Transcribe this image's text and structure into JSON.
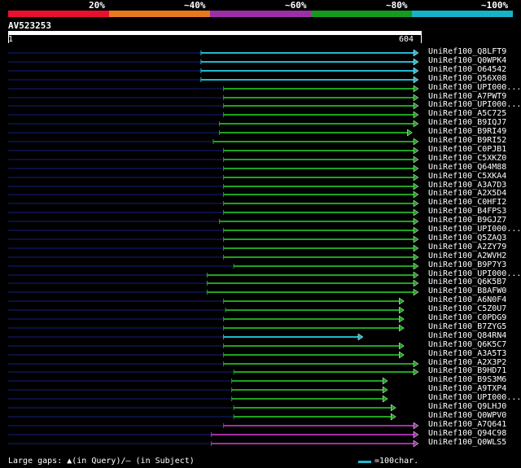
{
  "scale": {
    "segments": [
      {
        "color": "#e8112d"
      },
      {
        "color": "#e8781e"
      },
      {
        "color": "#9c2ea8"
      },
      {
        "color": "#169a1e"
      },
      {
        "color": "#14b4c6"
      }
    ],
    "labels": [
      "20%",
      "~40%",
      "~60%",
      "~80%",
      "~100%"
    ]
  },
  "query": {
    "name": "AV523253",
    "start": "1",
    "end": "604",
    "length": 604
  },
  "colors": {
    "cyan": "#22b8cf",
    "green": "#1fa31f",
    "purple": "#a030a8",
    "gap": "#0b1040",
    "gap_text": "#7a7a9a"
  },
  "hits": [
    {
      "id": "UniRef100_Q8LFT9",
      "color": "cyan",
      "qs": 0.47,
      "qe": 1.0
    },
    {
      "id": "UniRef100_Q0WPK4",
      "color": "cyan",
      "qs": 0.47,
      "qe": 1.0
    },
    {
      "id": "UniRef100_O64542",
      "color": "cyan",
      "qs": 0.47,
      "qe": 1.0
    },
    {
      "id": "UniRef100_Q56X08",
      "color": "cyan",
      "qs": 0.47,
      "qe": 1.0
    },
    {
      "id": "UniRef100_UPI000...",
      "color": "green",
      "qs": 0.525,
      "qe": 1.0
    },
    {
      "id": "UniRef100_A7PWT9",
      "color": "green",
      "qs": 0.525,
      "qe": 1.0
    },
    {
      "id": "UniRef100_UPI000...",
      "color": "green",
      "qs": 0.525,
      "qe": 1.0
    },
    {
      "id": "UniRef100_A5C725",
      "color": "green",
      "qs": 0.525,
      "qe": 1.0
    },
    {
      "id": "UniRef100_B9IQJ7",
      "color": "green",
      "qs": 0.515,
      "qe": 1.0
    },
    {
      "id": "UniRef100_B9RI49",
      "color": "green",
      "qs": 0.515,
      "qe": 0.985
    },
    {
      "id": "UniRef100_B9RI52",
      "color": "green",
      "qs": 0.5,
      "qe": 1.0
    },
    {
      "id": "UniRef100_C0PJB1",
      "color": "green",
      "qs": 0.525,
      "qe": 1.0
    },
    {
      "id": "UniRef100_C5XKZ0",
      "color": "green",
      "qs": 0.525,
      "qe": 1.0
    },
    {
      "id": "UniRef100_Q64M88",
      "color": "green",
      "qs": 0.525,
      "qe": 1.0
    },
    {
      "id": "UniRef100_C5XKA4",
      "color": "green",
      "qs": 0.525,
      "qe": 1.0
    },
    {
      "id": "UniRef100_A3A7D3",
      "color": "green",
      "qs": 0.525,
      "qe": 1.0
    },
    {
      "id": "UniRef100_A2X5D4",
      "color": "green",
      "qs": 0.525,
      "qe": 1.0
    },
    {
      "id": "UniRef100_C0HFI2",
      "color": "green",
      "qs": 0.525,
      "qe": 1.0
    },
    {
      "id": "UniRef100_B4FPS3",
      "color": "green",
      "qs": 0.525,
      "qe": 1.0
    },
    {
      "id": "UniRef100_B9GJZ7",
      "color": "green",
      "qs": 0.515,
      "qe": 1.0
    },
    {
      "id": "UniRef100_UPI000...",
      "color": "green",
      "qs": 0.525,
      "qe": 1.0
    },
    {
      "id": "UniRef100_Q5ZAQ3",
      "color": "green",
      "qs": 0.525,
      "qe": 1.0
    },
    {
      "id": "UniRef100_A2ZY79",
      "color": "green",
      "qs": 0.525,
      "qe": 1.0
    },
    {
      "id": "UniRef100_A2WVH2",
      "color": "green",
      "qs": 0.525,
      "qe": 1.0
    },
    {
      "id": "UniRef100_B9P7Y3",
      "color": "green",
      "qs": 0.55,
      "qe": 1.0
    },
    {
      "id": "UniRef100_UPI000...",
      "color": "green",
      "qs": 0.485,
      "qe": 1.0
    },
    {
      "id": "UniRef100_Q6K5B7",
      "color": "green",
      "qs": 0.485,
      "qe": 1.0
    },
    {
      "id": "UniRef100_B8AFW0",
      "color": "green",
      "qs": 0.485,
      "qe": 1.0
    },
    {
      "id": "UniRef100_A6N0F4",
      "color": "green",
      "qs": 0.525,
      "qe": 0.965
    },
    {
      "id": "UniRef100_C5Z0U7",
      "color": "green",
      "qs": 0.53,
      "qe": 0.965
    },
    {
      "id": "UniRef100_C0PDG9",
      "color": "green",
      "qs": 0.525,
      "qe": 0.965
    },
    {
      "id": "UniRef100_B7ZYG5",
      "color": "green",
      "qs": 0.525,
      "qe": 0.965
    },
    {
      "id": "UniRef100_Q84RN4",
      "color": "cyan",
      "qs": 0.525,
      "qe": 0.865
    },
    {
      "id": "UniRef100_Q6K5C7",
      "color": "green",
      "qs": 0.525,
      "qe": 0.965
    },
    {
      "id": "UniRef100_A3A5T3",
      "color": "green",
      "qs": 0.525,
      "qe": 0.965
    },
    {
      "id": "UniRef100_A2X3P2",
      "color": "green",
      "qs": 0.525,
      "qe": 1.0
    },
    {
      "id": "UniRef100_B9HD71",
      "color": "green",
      "qs": 0.55,
      "qe": 1.0
    },
    {
      "id": "UniRef100_B9S3M6",
      "color": "green",
      "qs": 0.545,
      "qe": 0.925
    },
    {
      "id": "UniRef100_A9TXP4",
      "color": "green",
      "qs": 0.545,
      "qe": 0.925
    },
    {
      "id": "UniRef100_UPI000...",
      "color": "green",
      "qs": 0.545,
      "qe": 0.925
    },
    {
      "id": "UniRef100_Q9LHJ0",
      "color": "green",
      "qs": 0.55,
      "qe": 0.945
    },
    {
      "id": "UniRef100_Q0WPV0",
      "color": "green",
      "qs": 0.55,
      "qe": 0.945
    },
    {
      "id": "UniRef100_A7Q641",
      "color": "purple",
      "qs": 0.525,
      "qe": 1.0
    },
    {
      "id": "UniRef100_Q94C98",
      "color": "purple",
      "qs": 0.495,
      "qe": 1.0
    },
    {
      "id": "UniRef100_Q0WLS5",
      "color": "purple",
      "qs": 0.495,
      "qe": 1.0
    }
  ],
  "legend": {
    "gaps_text": "Large gaps: ▲(in Query)/– (in Subject)",
    "scale_text": "=100char."
  }
}
